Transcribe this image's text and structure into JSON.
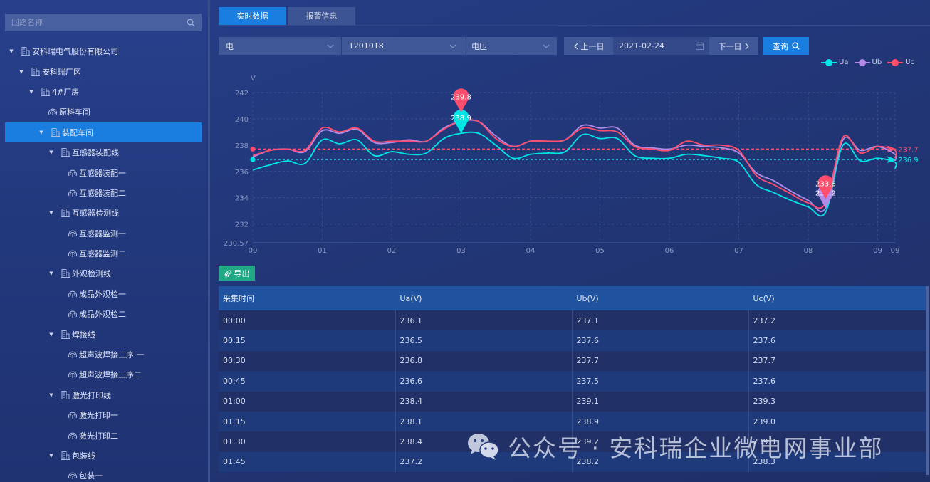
{
  "sidebar": {
    "search_placeholder": "回路名称",
    "tree": [
      {
        "label": "安科瑞电气股份有限公司",
        "level": 0,
        "type": "building",
        "expanded": true
      },
      {
        "label": "安科瑞厂区",
        "level": 1,
        "type": "building",
        "expanded": true
      },
      {
        "label": "4#厂房",
        "level": 2,
        "type": "building",
        "expanded": true
      },
      {
        "label": "原料车间",
        "level": 3,
        "type": "meter"
      },
      {
        "label": "装配车间",
        "level": 3,
        "type": "building",
        "expanded": true,
        "selected": true
      },
      {
        "label": "互感器装配线",
        "level": 4,
        "type": "building",
        "expanded": true
      },
      {
        "label": "互感器装配一",
        "level": 5,
        "type": "meter"
      },
      {
        "label": "互感器装配二",
        "level": 5,
        "type": "meter"
      },
      {
        "label": "互感器检测线",
        "level": 4,
        "type": "building",
        "expanded": true
      },
      {
        "label": "互感器监测一",
        "level": 5,
        "type": "meter"
      },
      {
        "label": "互感器监测二",
        "level": 5,
        "type": "meter"
      },
      {
        "label": "外观检测线",
        "level": 4,
        "type": "building",
        "expanded": true
      },
      {
        "label": "成品外观检一",
        "level": 5,
        "type": "meter"
      },
      {
        "label": "成品外观检二",
        "level": 5,
        "type": "meter"
      },
      {
        "label": "焊接线",
        "level": 4,
        "type": "building",
        "expanded": true
      },
      {
        "label": "超声波焊接工序 一",
        "level": 5,
        "type": "meter"
      },
      {
        "label": "超声波焊接工序二",
        "level": 5,
        "type": "meter"
      },
      {
        "label": "激光打印线",
        "level": 4,
        "type": "building",
        "expanded": true
      },
      {
        "label": "激光打印一",
        "level": 5,
        "type": "meter"
      },
      {
        "label": "激光打印二",
        "level": 5,
        "type": "meter"
      },
      {
        "label": "包装线",
        "level": 4,
        "type": "building",
        "expanded": true
      },
      {
        "label": "包装一",
        "level": 5,
        "type": "meter"
      }
    ]
  },
  "tabs": [
    {
      "label": "实时数据",
      "active": true
    },
    {
      "label": "报警信息",
      "active": false
    }
  ],
  "filters": {
    "energy_type": "电",
    "device": "T201018",
    "parameter": "电压",
    "prev_day": "上一日",
    "date": "2021-02-24",
    "next_day": "下一日",
    "query": "查询"
  },
  "export_label": "导出",
  "colors": {
    "Ua": "#00e5e5",
    "Ub": "#b08ce8",
    "Uc": "#ff4d6d",
    "accent": "#1a7ee0",
    "export": "#21a985"
  },
  "chart_data": {
    "type": "line",
    "title": "",
    "ylabel": "V",
    "xlabel": "",
    "ylim": [
      230.57,
      242
    ],
    "yticks": [
      "242",
      "240",
      "238",
      "236",
      "234",
      "232",
      "230.57"
    ],
    "ytick_values": [
      242,
      240,
      238,
      236,
      234,
      232,
      230.57
    ],
    "xticks": [
      "00",
      "01",
      "02",
      "03",
      "04",
      "05",
      "06",
      "07",
      "08",
      "09",
      "09"
    ],
    "x_step_minutes": 15,
    "grid": true,
    "legend_position": "top-right",
    "series": [
      {
        "name": "Ua",
        "values": [
          236.1,
          236.5,
          236.8,
          236.6,
          238.4,
          238.1,
          238.4,
          237.2,
          237.5,
          237.3,
          237.4,
          238.5,
          238.9,
          238.9,
          238.0,
          237.0,
          237.3,
          237.4,
          237.5,
          238.8,
          238.5,
          238.5,
          237.2,
          237.0,
          237.0,
          237.3,
          237.2,
          237.0,
          236.7,
          235.0,
          234.4,
          233.8,
          233.3,
          232.9,
          238.0,
          236.8,
          237.0,
          236.7,
          236.2
        ],
        "marker": {
          "label": "238.9",
          "at_index": 12
        },
        "avg_line": {
          "label": "236.9",
          "value": 236.9
        }
      },
      {
        "name": "Ub",
        "values": [
          237.1,
          237.6,
          237.7,
          237.5,
          239.1,
          238.9,
          239.2,
          238.2,
          238.2,
          238.4,
          238.3,
          239.3,
          239.8,
          239.8,
          238.7,
          237.9,
          238.3,
          238.3,
          238.4,
          239.5,
          239.3,
          239.3,
          238.0,
          237.8,
          237.7,
          238.0,
          237.9,
          237.8,
          237.4,
          235.9,
          235.3,
          234.5,
          233.8,
          233.2,
          238.4,
          237.6,
          237.9,
          237.3,
          236.8
        ],
        "marker": {
          "label": "233.2",
          "at_index": 33
        }
      },
      {
        "name": "Uc",
        "values": [
          237.2,
          237.6,
          237.7,
          237.6,
          239.3,
          239.0,
          239.3,
          238.3,
          238.3,
          238.3,
          238.3,
          239.2,
          239.8,
          239.8,
          238.5,
          237.9,
          238.3,
          238.3,
          238.4,
          239.3,
          239.1,
          239.0,
          237.9,
          237.7,
          237.6,
          238.3,
          238.0,
          238.0,
          237.6,
          235.7,
          235.0,
          234.3,
          233.6,
          233.6,
          238.6,
          237.4,
          237.9,
          237.6,
          237.0
        ],
        "marker": {
          "label": "239.8",
          "at_index": 12
        },
        "min_marker": {
          "label": "233.6",
          "at_index": 33
        },
        "avg_line": {
          "label": "237.7",
          "value": 237.7
        }
      }
    ]
  },
  "table": {
    "headers": [
      "采集时间",
      "Ua(V)",
      "Ub(V)",
      "Uc(V)"
    ],
    "rows": [
      [
        "00:00",
        "236.1",
        "237.1",
        "237.2"
      ],
      [
        "00:15",
        "236.5",
        "237.6",
        "237.6"
      ],
      [
        "00:30",
        "236.8",
        "237.7",
        "237.7"
      ],
      [
        "00:45",
        "236.6",
        "237.5",
        "237.6"
      ],
      [
        "01:00",
        "238.4",
        "239.1",
        "239.3"
      ],
      [
        "01:15",
        "238.1",
        "238.9",
        "239.0"
      ],
      [
        "01:30",
        "238.4",
        "239.2",
        "239.3"
      ],
      [
        "01:45",
        "237.2",
        "238.2",
        "238.3"
      ]
    ]
  },
  "watermark": "公众号 · 安科瑞企业微电网事业部"
}
